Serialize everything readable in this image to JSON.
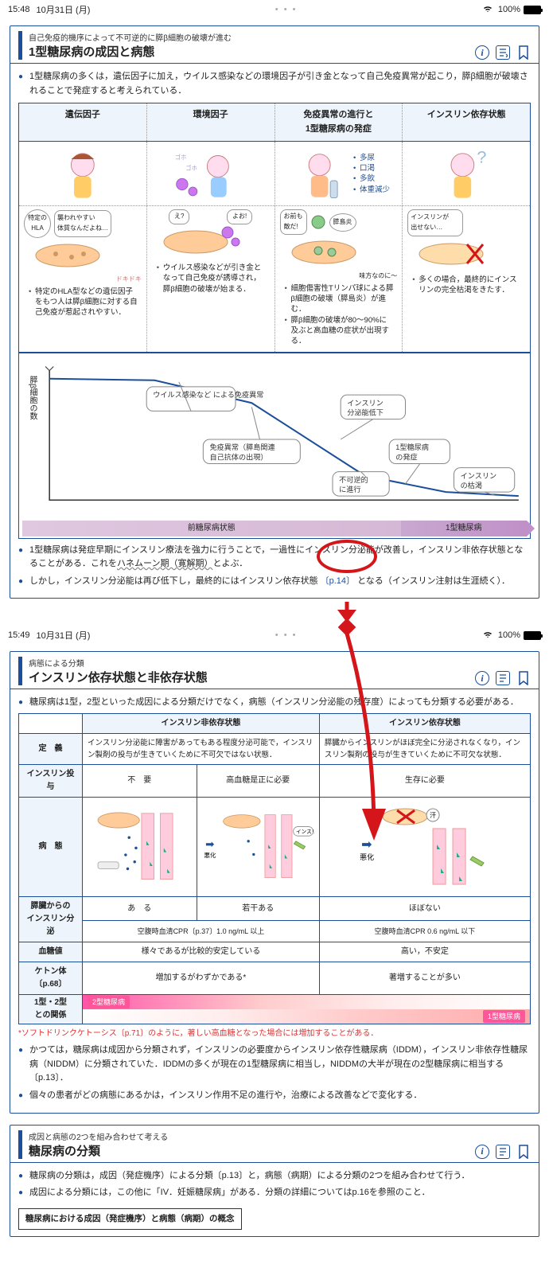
{
  "status1": {
    "time": "15:48",
    "date": "10月31日 (月)",
    "battery": "100%"
  },
  "status2": {
    "time": "15:49",
    "date": "10月31日 (月)",
    "battery": "100%"
  },
  "card1": {
    "sub": "自己免疫的機序によって不可逆的に膵β細胞の破壊が進む",
    "title": "1型糖尿病の成因と病態",
    "intro": "1型糖尿病の多くは，遺伝因子に加え，ウイルス感染などの環境因子が引き金となって自己免疫異常が起こり，膵β細胞が破壊されることで発症すると考えられている．",
    "cols": [
      "遺伝因子",
      "環境因子",
      "免疫異常の進行と\n1型糖尿病の発症",
      "インスリン依存状態"
    ],
    "symptoms": [
      "多尿",
      "口渇",
      "多飲",
      "体重減少"
    ],
    "bubble1a": "特定の\nHLA",
    "bubble1b": "襲われやすい\n体質なんだよね…",
    "bubble1c": "ドキドキ",
    "bubble2a": "え?",
    "bubble2b": "よお!",
    "bubble2c": "お前も\n敵だ!",
    "bubble3a": "膵島炎",
    "bubble3b": "味方なのに〜",
    "bubble4a": "インスリンが\n出せない…",
    "desc1": "特定のHLA型などの遺伝因子をもつ人は膵β細胞に対する自己免疫が惹起されやすい．",
    "desc2": "ウイルス感染などが引き金となって自己免疫が誘導され，膵β細胞の破壊が始まる．",
    "desc3a": "細胞傷害性Tリンパ球による膵β細胞の破壊（膵島炎）が進む．",
    "desc3b": "膵β細胞の破壊が80〜90%に及ぶと高血糖の症状が出現する．",
    "desc4": "多くの場合，最終的にインスリンの完全枯渇をきたす．",
    "graph_ylabel": "膵β細胞の数",
    "graph_labels": {
      "a": "ウイルス感染など\nによる免疫異常",
      "b": "免疫異常（膵島関連\n自己抗体の出現）",
      "c": "インスリン\n分泌能低下",
      "d": "不可逆的\nに進行",
      "e": "1型糖尿病\nの発症",
      "f": "インスリン\nの枯渇"
    },
    "timeline_pre": "前糖尿病状態",
    "timeline_post": "1型糖尿病",
    "foot1": "1型糖尿病は発症早期にインスリン療法を強力に行うことで，一過性にインスリン分泌能が改善し，インスリン非依存状態となることがある．これをハネムーン期（寛解期）とよぶ．",
    "foot2_a": "しかし，インスリン分泌能は再び低下し，最終的にはインスリン依存状態",
    "foot2_link": "〔p.14〕",
    "foot2_b": "となる（インスリン注射は生涯続く）．"
  },
  "card2": {
    "sub": "病態による分類",
    "title": "インスリン依存状態と非依存状態",
    "intro": "糖尿病は1型，2型といった成因による分類だけでなく，病態（インスリン分泌能の残存度）によっても分類する必要がある．",
    "headers": {
      "col1": "インスリン非依存状態",
      "col2": "インスリン依存状態"
    },
    "rows": {
      "def": {
        "h": "定　義",
        "c1": "インスリン分泌能に障害があってもある程度分泌可能で，インスリン製剤の投与が生きていくために不可欠ではない状態．",
        "c2": "膵臓からインスリンがほぼ完全に分泌されなくなり，インスリン製剤の投与が生きていくために不可欠な状態．"
      },
      "inj": {
        "h": "インスリン投与",
        "a": "不　要",
        "b": "高血糖是正に必要",
        "c": "生存に必要"
      },
      "patho": {
        "h": "病　態",
        "label_insulin": "インスリン",
        "label_worse": "悪化"
      },
      "secr": {
        "h": "膵臓からの\nインスリン分泌",
        "a": "あ　る",
        "b": "若干ある",
        "c": "ほぼない",
        "sub_b": "空腹時血清CPR〔p.37〕1.0 ng/mL 以上",
        "sub_c": "空腹時血清CPR 0.6 ng/mL 以下"
      },
      "glu": {
        "h": "血糖値",
        "a": "様々であるが比較的安定している",
        "b": "高い，不安定"
      },
      "ket": {
        "h": "ケトン体〔p.68〕",
        "a": "増加するがわずかである*",
        "b": "著増することが多い"
      },
      "rel": {
        "h": "1型・2型\nとの関係",
        "l1": "2型糖尿病",
        "l2": "1型糖尿病"
      }
    },
    "redfoot": "*ソフトドリンクケトーシス〔p.71〕のように，著しい高血糖となった場合には増加することがある．",
    "b1": "かつては，糖尿病は成因から分類されず，インスリンの必要度からインスリン依存性糖尿病（IDDM），インスリン非依存性糖尿病（NIDDM）に分類されていた．IDDMの多くが現在の1型糖尿病に相当し，NIDDMの大半が現在の2型糖尿病に相当する〔p.13〕．",
    "b2": "個々の患者がどの病態にあるかは，インスリン作用不足の進行や，治療による改善などで変化する．"
  },
  "card3": {
    "sub": "成因と病態の2つを組み合わせて考える",
    "title": "糖尿病の分類",
    "b1": "糖尿病の分類は，成因（発症機序）による分類〔p.13〕と，病態（病期）による分類の2つを組み合わせて行う．",
    "b2": "成因による分類には，この他に「IV．妊娠糖尿病」がある．分類の詳細についてはp.16を参照のこと．",
    "boxtitle": "糖尿病における成因（発症機序）と病態（病期）の概念"
  }
}
